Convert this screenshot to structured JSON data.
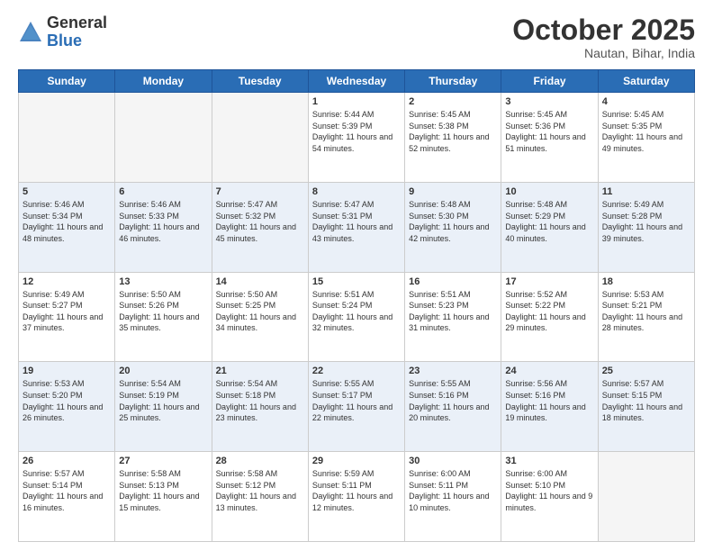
{
  "header": {
    "logo_general": "General",
    "logo_blue": "Blue",
    "month": "October 2025",
    "location": "Nautan, Bihar, India"
  },
  "weekdays": [
    "Sunday",
    "Monday",
    "Tuesday",
    "Wednesday",
    "Thursday",
    "Friday",
    "Saturday"
  ],
  "rows": [
    {
      "odd": false,
      "cells": [
        {
          "day": "",
          "empty": true
        },
        {
          "day": "",
          "empty": true
        },
        {
          "day": "",
          "empty": true
        },
        {
          "day": "1",
          "sunrise": "Sunrise: 5:44 AM",
          "sunset": "Sunset: 5:39 PM",
          "daylight": "Daylight: 11 hours and 54 minutes."
        },
        {
          "day": "2",
          "sunrise": "Sunrise: 5:45 AM",
          "sunset": "Sunset: 5:38 PM",
          "daylight": "Daylight: 11 hours and 52 minutes."
        },
        {
          "day": "3",
          "sunrise": "Sunrise: 5:45 AM",
          "sunset": "Sunset: 5:36 PM",
          "daylight": "Daylight: 11 hours and 51 minutes."
        },
        {
          "day": "4",
          "sunrise": "Sunrise: 5:45 AM",
          "sunset": "Sunset: 5:35 PM",
          "daylight": "Daylight: 11 hours and 49 minutes."
        }
      ]
    },
    {
      "odd": true,
      "cells": [
        {
          "day": "5",
          "sunrise": "Sunrise: 5:46 AM",
          "sunset": "Sunset: 5:34 PM",
          "daylight": "Daylight: 11 hours and 48 minutes."
        },
        {
          "day": "6",
          "sunrise": "Sunrise: 5:46 AM",
          "sunset": "Sunset: 5:33 PM",
          "daylight": "Daylight: 11 hours and 46 minutes."
        },
        {
          "day": "7",
          "sunrise": "Sunrise: 5:47 AM",
          "sunset": "Sunset: 5:32 PM",
          "daylight": "Daylight: 11 hours and 45 minutes."
        },
        {
          "day": "8",
          "sunrise": "Sunrise: 5:47 AM",
          "sunset": "Sunset: 5:31 PM",
          "daylight": "Daylight: 11 hours and 43 minutes."
        },
        {
          "day": "9",
          "sunrise": "Sunrise: 5:48 AM",
          "sunset": "Sunset: 5:30 PM",
          "daylight": "Daylight: 11 hours and 42 minutes."
        },
        {
          "day": "10",
          "sunrise": "Sunrise: 5:48 AM",
          "sunset": "Sunset: 5:29 PM",
          "daylight": "Daylight: 11 hours and 40 minutes."
        },
        {
          "day": "11",
          "sunrise": "Sunrise: 5:49 AM",
          "sunset": "Sunset: 5:28 PM",
          "daylight": "Daylight: 11 hours and 39 minutes."
        }
      ]
    },
    {
      "odd": false,
      "cells": [
        {
          "day": "12",
          "sunrise": "Sunrise: 5:49 AM",
          "sunset": "Sunset: 5:27 PM",
          "daylight": "Daylight: 11 hours and 37 minutes."
        },
        {
          "day": "13",
          "sunrise": "Sunrise: 5:50 AM",
          "sunset": "Sunset: 5:26 PM",
          "daylight": "Daylight: 11 hours and 35 minutes."
        },
        {
          "day": "14",
          "sunrise": "Sunrise: 5:50 AM",
          "sunset": "Sunset: 5:25 PM",
          "daylight": "Daylight: 11 hours and 34 minutes."
        },
        {
          "day": "15",
          "sunrise": "Sunrise: 5:51 AM",
          "sunset": "Sunset: 5:24 PM",
          "daylight": "Daylight: 11 hours and 32 minutes."
        },
        {
          "day": "16",
          "sunrise": "Sunrise: 5:51 AM",
          "sunset": "Sunset: 5:23 PM",
          "daylight": "Daylight: 11 hours and 31 minutes."
        },
        {
          "day": "17",
          "sunrise": "Sunrise: 5:52 AM",
          "sunset": "Sunset: 5:22 PM",
          "daylight": "Daylight: 11 hours and 29 minutes."
        },
        {
          "day": "18",
          "sunrise": "Sunrise: 5:53 AM",
          "sunset": "Sunset: 5:21 PM",
          "daylight": "Daylight: 11 hours and 28 minutes."
        }
      ]
    },
    {
      "odd": true,
      "cells": [
        {
          "day": "19",
          "sunrise": "Sunrise: 5:53 AM",
          "sunset": "Sunset: 5:20 PM",
          "daylight": "Daylight: 11 hours and 26 minutes."
        },
        {
          "day": "20",
          "sunrise": "Sunrise: 5:54 AM",
          "sunset": "Sunset: 5:19 PM",
          "daylight": "Daylight: 11 hours and 25 minutes."
        },
        {
          "day": "21",
          "sunrise": "Sunrise: 5:54 AM",
          "sunset": "Sunset: 5:18 PM",
          "daylight": "Daylight: 11 hours and 23 minutes."
        },
        {
          "day": "22",
          "sunrise": "Sunrise: 5:55 AM",
          "sunset": "Sunset: 5:17 PM",
          "daylight": "Daylight: 11 hours and 22 minutes."
        },
        {
          "day": "23",
          "sunrise": "Sunrise: 5:55 AM",
          "sunset": "Sunset: 5:16 PM",
          "daylight": "Daylight: 11 hours and 20 minutes."
        },
        {
          "day": "24",
          "sunrise": "Sunrise: 5:56 AM",
          "sunset": "Sunset: 5:16 PM",
          "daylight": "Daylight: 11 hours and 19 minutes."
        },
        {
          "day": "25",
          "sunrise": "Sunrise: 5:57 AM",
          "sunset": "Sunset: 5:15 PM",
          "daylight": "Daylight: 11 hours and 18 minutes."
        }
      ]
    },
    {
      "odd": false,
      "cells": [
        {
          "day": "26",
          "sunrise": "Sunrise: 5:57 AM",
          "sunset": "Sunset: 5:14 PM",
          "daylight": "Daylight: 11 hours and 16 minutes."
        },
        {
          "day": "27",
          "sunrise": "Sunrise: 5:58 AM",
          "sunset": "Sunset: 5:13 PM",
          "daylight": "Daylight: 11 hours and 15 minutes."
        },
        {
          "day": "28",
          "sunrise": "Sunrise: 5:58 AM",
          "sunset": "Sunset: 5:12 PM",
          "daylight": "Daylight: 11 hours and 13 minutes."
        },
        {
          "day": "29",
          "sunrise": "Sunrise: 5:59 AM",
          "sunset": "Sunset: 5:11 PM",
          "daylight": "Daylight: 11 hours and 12 minutes."
        },
        {
          "day": "30",
          "sunrise": "Sunrise: 6:00 AM",
          "sunset": "Sunset: 5:11 PM",
          "daylight": "Daylight: 11 hours and 10 minutes."
        },
        {
          "day": "31",
          "sunrise": "Sunrise: 6:00 AM",
          "sunset": "Sunset: 5:10 PM",
          "daylight": "Daylight: 11 hours and 9 minutes."
        },
        {
          "day": "",
          "empty": true
        }
      ]
    }
  ]
}
